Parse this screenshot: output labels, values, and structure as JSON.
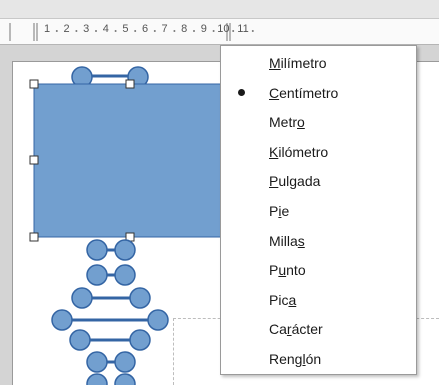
{
  "ruler": {
    "labels": [
      "1",
      "2",
      "3",
      "4",
      "5",
      "6",
      "7",
      "8",
      "9",
      "10",
      "11"
    ]
  },
  "menu": {
    "items": [
      {
        "label": "Milímetro",
        "underline_index": 0,
        "selected": false
      },
      {
        "label": "Centímetro",
        "underline_index": 0,
        "selected": true
      },
      {
        "label": "Metro",
        "underline_index": 4,
        "selected": false
      },
      {
        "label": "Kilómetro",
        "underline_index": 0,
        "selected": false
      },
      {
        "label": "Pulgada",
        "underline_index": 0,
        "selected": false
      },
      {
        "label": "Pie",
        "underline_index": 1,
        "selected": false
      },
      {
        "label": "Millas",
        "underline_index": 5,
        "selected": false
      },
      {
        "label": "Punto",
        "underline_index": 1,
        "selected": false
      },
      {
        "label": "Pica",
        "underline_index": 3,
        "selected": false
      },
      {
        "label": "Carácter",
        "underline_index": 2,
        "selected": false
      },
      {
        "label": "Renglón",
        "underline_index": 4,
        "selected": false
      }
    ]
  },
  "colors": {
    "shape_fill": "#729fcf",
    "shape_stroke": "#3465a4",
    "menu_text": "#1a1a1a"
  },
  "icons": {
    "selected_marker": "radio-dot-icon"
  }
}
